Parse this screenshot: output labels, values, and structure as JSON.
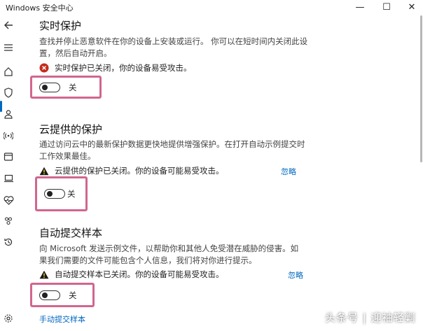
{
  "window": {
    "title": "Windows 安全中心",
    "controls": [
      "—",
      "☐",
      "✕"
    ]
  },
  "sidebar": {
    "icons": [
      "back-arrow-icon",
      "menu-icon",
      "home-icon",
      "shield-icon",
      "person-icon",
      "wifi-icon",
      "app-window-icon",
      "laptop-icon",
      "heart-icon",
      "family-icon",
      "history-icon",
      "settings-icon"
    ]
  },
  "sections": {
    "realtime": {
      "title": "实时保护",
      "desc": "查找并停止恶意软件在你的设备上安装或运行。 你可以在短时间内关闭此设置，然后自动开启。",
      "status": "实时保护已关闭，你的设备易受攻击。",
      "toggle_label": "关"
    },
    "cloud": {
      "title": "云提供的保护",
      "desc": "通过访问云中的最新保护数据更快地提供增强保护。在打开自动示例提交时工作效果最佳。",
      "status": "云提供的保护已关闭。你的设备可能易受攻击。",
      "ignore": "忽略",
      "toggle_label": "关"
    },
    "sample": {
      "title": "自动提交样本",
      "desc": "向 Microsoft 发送示例文件，以帮助你和其他人免受潜在威胁的侵害。如果我们需要的文件可能包含个人信息，我们将对你进行提示。",
      "status": "自动提交样本已关闭。你的设备可能易受攻击。",
      "ignore": "忽略",
      "toggle_label": "关",
      "link": "手动提交样本"
    }
  },
  "watermark": "头条号 | 迎袖轻剿",
  "colors": {
    "accent": "#0067c0",
    "highlight": "#d1668f",
    "error": "#c42b1c",
    "warning": "#1b1b1b"
  }
}
